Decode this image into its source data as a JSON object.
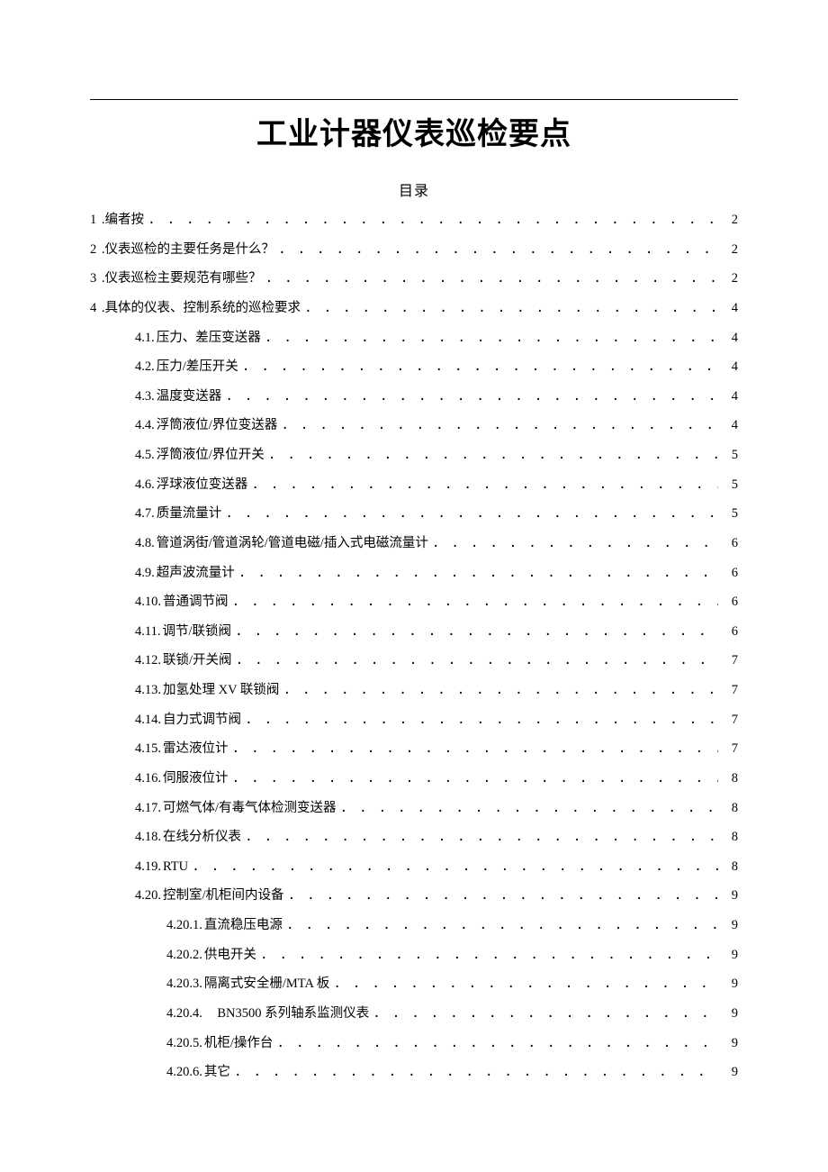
{
  "title": "工业计器仪表巡检要点",
  "toc_heading": "目录",
  "toc": [
    {
      "level": 1,
      "num": "1 ",
      "label": ".编者按",
      "page": "2"
    },
    {
      "level": 1,
      "num": "2 ",
      "label": ".仪表巡检的主要任务是什么？",
      "page": "2"
    },
    {
      "level": 1,
      "num": "3 ",
      "label": ".仪表巡检主要规范有哪些？",
      "page": "2"
    },
    {
      "level": 1,
      "num": "4 ",
      "label": ".具体的仪表、控制系统的巡检要求",
      "page": "4"
    },
    {
      "level": 2,
      "num": "4.1.",
      "label": "压力、差压变送器",
      "page": "4"
    },
    {
      "level": 2,
      "num": "4.2.",
      "label": "压力/差压开关",
      "page": "4"
    },
    {
      "level": 2,
      "num": "4.3.",
      "label": "温度变送器",
      "page": "4"
    },
    {
      "level": 2,
      "num": "4.4.",
      "label": "浮筒液位/界位变送器",
      "page": "4"
    },
    {
      "level": 2,
      "num": "4.5.",
      "label": "浮筒液位/界位开关",
      "page": "5"
    },
    {
      "level": 2,
      "num": "4.6.",
      "label": "浮球液位变送器",
      "page": "5"
    },
    {
      "level": 2,
      "num": "4.7.",
      "label": "质量流量计",
      "page": "5"
    },
    {
      "level": 2,
      "num": "4.8.",
      "label": "管道涡街/管道涡轮/管道电磁/插入式电磁流量计",
      "page": "6"
    },
    {
      "level": 2,
      "num": "4.9.",
      "label": "超声波流量计",
      "page": "6"
    },
    {
      "level": 2,
      "num": "4.10.",
      "label": "普通调节阀",
      "page": "6"
    },
    {
      "level": 2,
      "num": "4.11.",
      "label": "调节/联锁阀",
      "page": "6"
    },
    {
      "level": 2,
      "num": "4.12.",
      "label": "联锁/开关阀",
      "page": "7"
    },
    {
      "level": 2,
      "num": "4.13.",
      "label": "加氢处理 XV 联锁阀",
      "page": "7"
    },
    {
      "level": 2,
      "num": "4.14.",
      "label": "自力式调节阀",
      "page": "7"
    },
    {
      "level": 2,
      "num": "4.15.",
      "label": "雷达液位计",
      "page": "7"
    },
    {
      "level": 2,
      "num": "4.16.",
      "label": "伺服液位计",
      "page": "8"
    },
    {
      "level": 2,
      "num": "4.17.",
      "label": "可燃气体/有毒气体检测变送器",
      "page": "8"
    },
    {
      "level": 2,
      "num": "4.18.",
      "label": "在线分析仪表",
      "page": "8"
    },
    {
      "level": 2,
      "num": "4.19.",
      "label": "RTU",
      "page": "8"
    },
    {
      "level": 2,
      "num": "4.20.",
      "label": "控制室/机柜间内设备",
      "page": "9"
    },
    {
      "level": 3,
      "num": "4.20.1.",
      "label": "直流稳压电源",
      "page": "9"
    },
    {
      "level": 3,
      "num": "4.20.2.",
      "label": "供电开关",
      "page": "9"
    },
    {
      "level": 3,
      "num": "4.20.3.",
      "label": "隔离式安全栅/MTA 板",
      "page": "9"
    },
    {
      "level": 3,
      "num": "4.20.4.",
      "label": " BN3500 系列轴系监测仪表",
      "page": "9"
    },
    {
      "level": 3,
      "num": "4.20.5.",
      "label": "机柜/操作台",
      "page": "9"
    },
    {
      "level": 3,
      "num": "4.20.6.",
      "label": "其它",
      "page": "9"
    }
  ]
}
